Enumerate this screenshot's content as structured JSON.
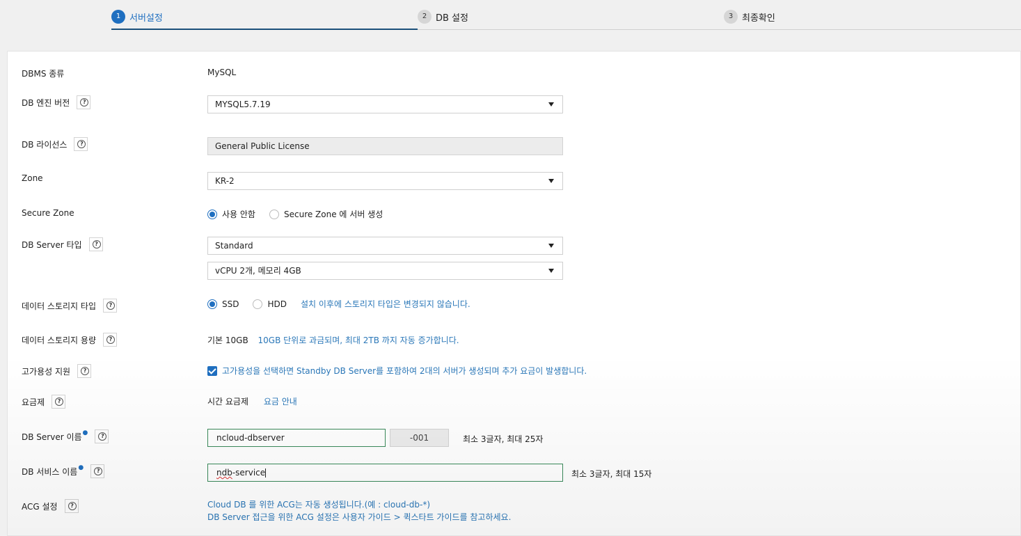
{
  "steps": [
    {
      "num": "1",
      "label": "서버설정",
      "active": true
    },
    {
      "num": "2",
      "label": "DB 설정",
      "active": false
    },
    {
      "num": "3",
      "label": "최종확인",
      "active": false
    }
  ],
  "form": {
    "dbms_type": {
      "label": "DBMS 종류",
      "value": "MySQL"
    },
    "engine_version": {
      "label": "DB 엔진 버전",
      "value": "MYSQL5.7.19"
    },
    "license": {
      "label": "DB 라이선스",
      "value": "General Public License"
    },
    "zone": {
      "label": "Zone",
      "value": "KR-2"
    },
    "secure_zone": {
      "label": "Secure Zone",
      "options": [
        "사용 안함",
        "Secure Zone 에 서버 생성"
      ],
      "selected": "사용 안함"
    },
    "server_type": {
      "label": "DB Server 타입",
      "type_value": "Standard",
      "spec_value": "vCPU 2개, 메모리 4GB"
    },
    "storage_type": {
      "label": "데이터 스토리지 타입",
      "options": [
        "SSD",
        "HDD"
      ],
      "selected": "SSD",
      "note": "설치 이후에 스토리지 타입은 변경되지 않습니다."
    },
    "storage_size": {
      "label": "데이터 스토리지 용량",
      "value": "기본 10GB",
      "note": "10GB 단위로 과금되며, 최대 2TB 까지 자동 증가합니다."
    },
    "high_availability": {
      "label": "고가용성 지원",
      "checked": true,
      "note": "고가용성을 선택하면 Standby DB Server를 포함하여 2대의 서버가 생성되며 추가 요금이 발생합니다."
    },
    "pricing": {
      "label": "요금제",
      "value": "시간 요금제",
      "link": "요금 안내"
    },
    "server_name": {
      "label": "DB Server 이름",
      "value": "ncloud-dbserver",
      "suffix": "-001",
      "hint": "최소 3글자, 최대 25자"
    },
    "service_name": {
      "label": "DB 서비스 이름",
      "value_prefix": "ndb",
      "value_rest": "-service",
      "hint": "최소 3글자, 최대 15자"
    },
    "acg": {
      "label": "ACG 설정",
      "line1": "Cloud DB 를 위한 ACG는 자동 생성됩니다.(예 : cloud-db-*)",
      "line2": "DB Server 접근을 위한 ACG 설정은 사용자 가이드 > 퀵스타트 가이드를 참고하세요."
    }
  }
}
